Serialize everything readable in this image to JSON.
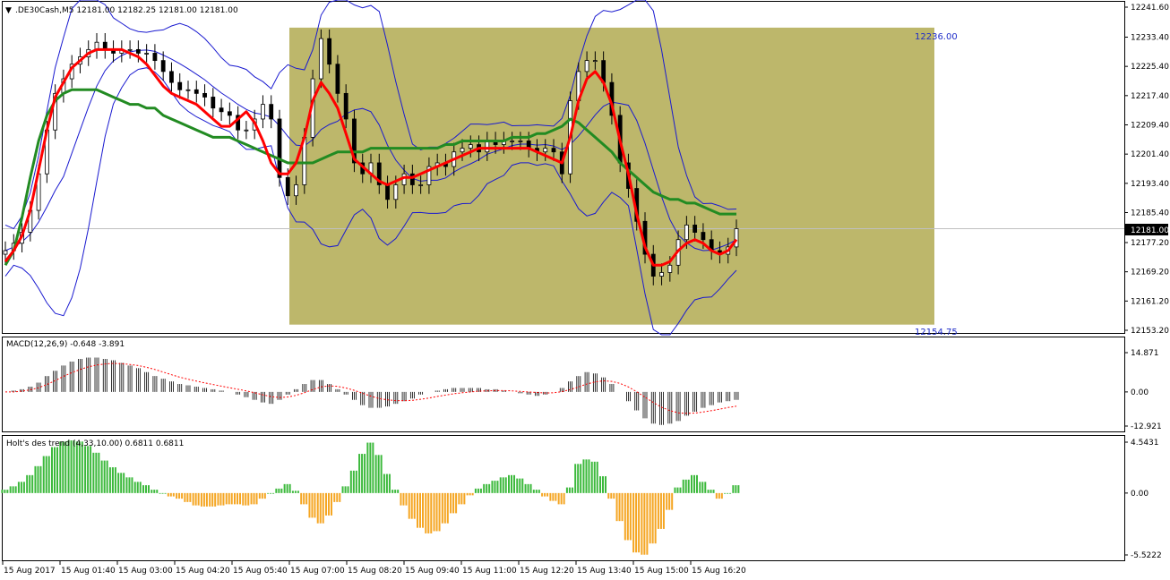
{
  "window": {
    "symbol_header": ".DE30Cash,M5  12181.00 12182.25 12181.00 12181.00",
    "current_price_label": "12181.00"
  },
  "colors": {
    "bg": "#ffffff",
    "rect_fill": "#bdb76b",
    "bollinger": "#1a1ad0",
    "ma_fast": "#ff0000",
    "ma_slow": "#228b22",
    "candle": "#000000",
    "hist_up": "#3cb93c",
    "hist_down": "#f5a623",
    "macd_signal": "#ff0000"
  },
  "chart_data": [
    {
      "type": "line",
      "panel": "main",
      "title": ".DE30Cash,M5  12181.00 12182.25 12181.00 12181.00",
      "y_ticks": [
        "12241.60",
        "12233.40",
        "12225.40",
        "12217.40",
        "12209.40",
        "12201.40",
        "12193.40",
        "12185.40",
        "12177.20",
        "12169.20",
        "12161.20",
        "12153.20"
      ],
      "ylim": [
        12153.2,
        12241.6
      ],
      "current_price": 12181.0,
      "rectangle": {
        "top_value": 12236.0,
        "bottom_value": 12154.75,
        "top_label": "12236.00",
        "bottom_label": "12154.75"
      },
      "x_ticks": [
        "15 Aug 2017",
        "15 Aug 01:40",
        "15 Aug 03:00",
        "15 Aug 04:20",
        "15 Aug 05:40",
        "15 Aug 07:00",
        "15 Aug 08:20",
        "15 Aug 09:40",
        "15 Aug 11:00",
        "15 Aug 12:20",
        "15 Aug 13:40",
        "15 Aug 15:00",
        "15 Aug 16:20"
      ],
      "series": [
        {
          "name": "close",
          "values": [
            12175,
            12177,
            12180,
            12186,
            12196,
            12208,
            12218,
            12222,
            12226,
            12228,
            12230,
            12232,
            12230,
            12229,
            12230,
            12230,
            12229,
            12229,
            12227,
            12224,
            12221,
            12219,
            12219,
            12218,
            12217,
            12214,
            12213,
            12212,
            12208,
            12208,
            12211,
            12215,
            12211,
            12195,
            12190,
            12193,
            12206,
            12222,
            12233,
            12226,
            12218,
            12211,
            12199,
            12196,
            12199,
            12193,
            12189,
            12193,
            12196,
            12193,
            12193,
            12198,
            12199,
            12198,
            12202,
            12203,
            12204,
            12202,
            12205,
            12204,
            12205,
            12205,
            12205,
            12203,
            12202,
            12203,
            12202,
            12196,
            12216,
            12224,
            12227,
            12227,
            12221,
            12212,
            12199,
            12192,
            12183,
            12174,
            12168,
            12169,
            12171,
            12178,
            12182,
            12180,
            12178,
            12175,
            12174,
            12176,
            12181
          ]
        },
        {
          "name": "ma_fast",
          "values": [
            12172,
            12175,
            12179,
            12186,
            12197,
            12208,
            12217,
            12221,
            12225,
            12227,
            12229,
            12230,
            12230,
            12230,
            12230,
            12229,
            12228,
            12226,
            12223,
            12220,
            12218,
            12217,
            12216,
            12215,
            12213,
            12211,
            12209,
            12209,
            12211,
            12213,
            12210,
            12205,
            12199,
            12196,
            12196,
            12199,
            12206,
            12216,
            12221,
            12218,
            12214,
            12207,
            12200,
            12198,
            12196,
            12194,
            12193,
            12194,
            12195,
            12195,
            12196,
            12197,
            12198,
            12199,
            12200,
            12201,
            12202,
            12203,
            12203,
            12203,
            12203,
            12203,
            12203,
            12203,
            12202,
            12201,
            12200,
            12199,
            12206,
            12216,
            12222,
            12224,
            12221,
            12215,
            12205,
            12196,
            12185,
            12176,
            12171,
            12171,
            12172,
            12175,
            12177,
            12178,
            12177,
            12175,
            12174,
            12175,
            12178
          ]
        },
        {
          "name": "ma_slow",
          "values": [
            12171,
            12175,
            12184,
            12195,
            12205,
            12212,
            12216,
            12218,
            12219,
            12219,
            12219,
            12219,
            12218,
            12217,
            12216,
            12215,
            12215,
            12214,
            12214,
            12212,
            12211,
            12210,
            12209,
            12208,
            12207,
            12206,
            12206,
            12206,
            12205,
            12204,
            12203,
            12202,
            12201,
            12200,
            12199,
            12199,
            12199,
            12199,
            12200,
            12201,
            12202,
            12202,
            12202,
            12202,
            12203,
            12203,
            12203,
            12203,
            12203,
            12203,
            12203,
            12203,
            12203,
            12204,
            12204,
            12205,
            12205,
            12205,
            12205,
            12205,
            12205,
            12206,
            12206,
            12206,
            12207,
            12207,
            12208,
            12209,
            12211,
            12210,
            12208,
            12206,
            12204,
            12202,
            12199,
            12197,
            12195,
            12193,
            12191,
            12190,
            12189,
            12189,
            12188,
            12188,
            12187,
            12186,
            12185,
            12185,
            12185
          ]
        }
      ]
    },
    {
      "type": "bar",
      "panel": "macd",
      "title": "MACD(12,26,9) -0.648 -3.891",
      "y_ticks": [
        "14.871",
        "0.00",
        "-12.921"
      ],
      "ylim": [
        -12.921,
        14.871
      ],
      "series": [
        {
          "name": "histogram",
          "values": [
            0,
            0.5,
            1,
            2,
            3.5,
            6,
            8,
            10,
            11.5,
            12.5,
            13,
            13,
            12.5,
            12,
            11,
            10,
            9,
            7.5,
            6,
            5,
            4,
            3,
            2.5,
            2,
            1.5,
            1,
            0.5,
            0,
            -1,
            -2,
            -3,
            -4,
            -4.5,
            -3,
            -1,
            1,
            3,
            4.5,
            4.5,
            3,
            1,
            -1,
            -3,
            -5,
            -6,
            -6,
            -5.5,
            -4.5,
            -3.5,
            -2.5,
            -1,
            0,
            0.5,
            1,
            1.5,
            1.5,
            1.5,
            1.5,
            1,
            1,
            0.5,
            0,
            -0.5,
            -1,
            -1.5,
            -1,
            0,
            1.5,
            4,
            6,
            7.5,
            7,
            5.5,
            3,
            0,
            -3.5,
            -7,
            -10,
            -12,
            -12.5,
            -12,
            -11,
            -9,
            -7.5,
            -6,
            -5,
            -4,
            -3.5,
            -3
          ]
        },
        {
          "name": "signal",
          "values": [
            0,
            0,
            0.3,
            0.8,
            1.6,
            2.8,
            4.3,
            5.9,
            7.3,
            8.5,
            9.5,
            10.2,
            10.6,
            10.8,
            10.7,
            10.4,
            10,
            9.3,
            8.5,
            7.5,
            6.5,
            5.6,
            4.8,
            4.1,
            3.4,
            2.8,
            2.2,
            1.6,
            1,
            0.4,
            -0.3,
            -1.1,
            -1.8,
            -2.1,
            -1.9,
            -1.3,
            -0.3,
            0.9,
            1.9,
            2.3,
            2.1,
            1.5,
            0.6,
            -0.5,
            -1.6,
            -2.5,
            -3,
            -3.3,
            -3.3,
            -3.2,
            -2.8,
            -2.3,
            -1.7,
            -1.2,
            -0.7,
            -0.3,
            0,
            0.3,
            0.4,
            0.5,
            0.5,
            0.4,
            0.2,
            0,
            -0.2,
            -0.4,
            -0.3,
            0.1,
            0.9,
            1.9,
            3,
            3.8,
            4.2,
            4,
            3.2,
            1.9,
            0.1,
            -2,
            -4,
            -5.8,
            -7.1,
            -7.9,
            -8.1,
            -8,
            -7.6,
            -7.1,
            -6.5,
            -5.9,
            -5.4
          ]
        }
      ]
    },
    {
      "type": "bar",
      "panel": "holt",
      "title": "Holt's des trend (4,33,10.00) 0.6811 0.6811",
      "y_ticks": [
        "4.5431",
        "0.00",
        "-5.5222"
      ],
      "ylim": [
        -5.5222,
        4.5431
      ],
      "series": [
        {
          "name": "trend",
          "values": [
            0.3,
            0.6,
            1,
            1.6,
            2.4,
            3.3,
            4.1,
            4.6,
            4.7,
            4.6,
            4.2,
            3.6,
            2.9,
            2.3,
            1.8,
            1.4,
            1,
            0.7,
            0.3,
            0,
            -0.3,
            -0.5,
            -0.8,
            -1.1,
            -1.2,
            -1.2,
            -1.1,
            -1,
            -1,
            -1.1,
            -1,
            -0.5,
            0,
            0.4,
            0.8,
            0.2,
            -1,
            -2.2,
            -2.7,
            -2,
            -0.8,
            0.6,
            2,
            3.5,
            4.5,
            3.4,
            1.7,
            0.3,
            -1.1,
            -2.3,
            -3.1,
            -3.6,
            -3.4,
            -2.7,
            -1.8,
            -1,
            -0.2,
            0.4,
            0.8,
            1.1,
            1.4,
            1.6,
            1.3,
            0.8,
            0.3,
            -0.3,
            -0.7,
            -1,
            0.5,
            2.6,
            3,
            2.8,
            1.5,
            -0.5,
            -2.5,
            -4.2,
            -5.3,
            -5.5,
            -4.5,
            -3.2,
            -1.5,
            0.5,
            1.2,
            1.6,
            1,
            0.3,
            -0.5,
            0,
            0.7
          ]
        }
      ]
    }
  ]
}
